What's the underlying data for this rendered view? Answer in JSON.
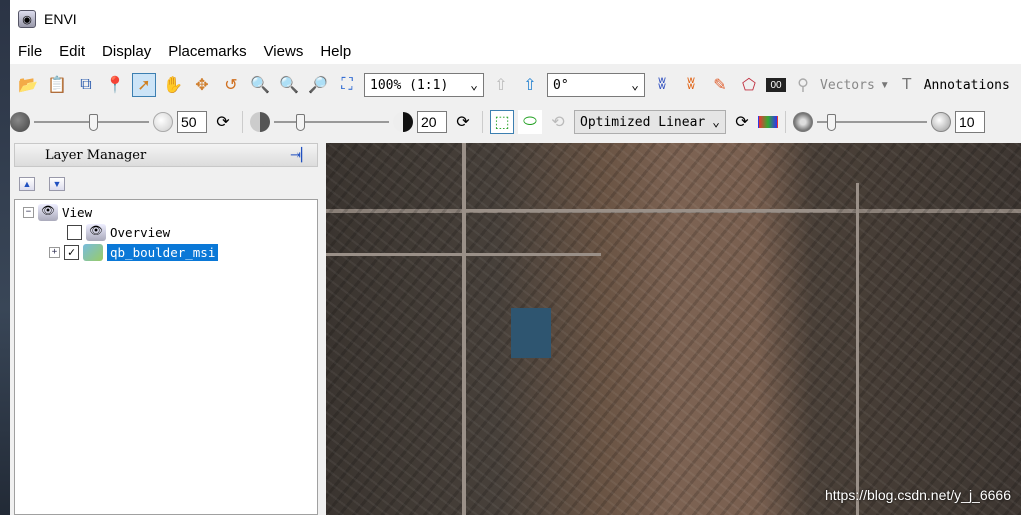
{
  "window": {
    "title": "ENVI"
  },
  "menu": [
    "File",
    "Edit",
    "Display",
    "Placemarks",
    "Views",
    "Help"
  ],
  "toolbar1": {
    "zoom_value": "100% (1:1)",
    "rotation_value": "0°",
    "vectors_label": "Vectors",
    "annotations_label": "Annotations"
  },
  "toolbar2": {
    "brightness_value": "50",
    "contrast_value": "20",
    "stretch_value": "Optimized Linear",
    "transparency_value": "10",
    "brightness_level": 50,
    "contrast_level": 20,
    "transparency_level": 10
  },
  "layer_manager": {
    "title": "Layer Manager",
    "tree": {
      "root": "View",
      "overview": "Overview",
      "layer": "qb_boulder_msi",
      "overview_checked": false,
      "layer_checked": true
    }
  },
  "watermark": "https://blog.csdn.net/y_j_6666"
}
